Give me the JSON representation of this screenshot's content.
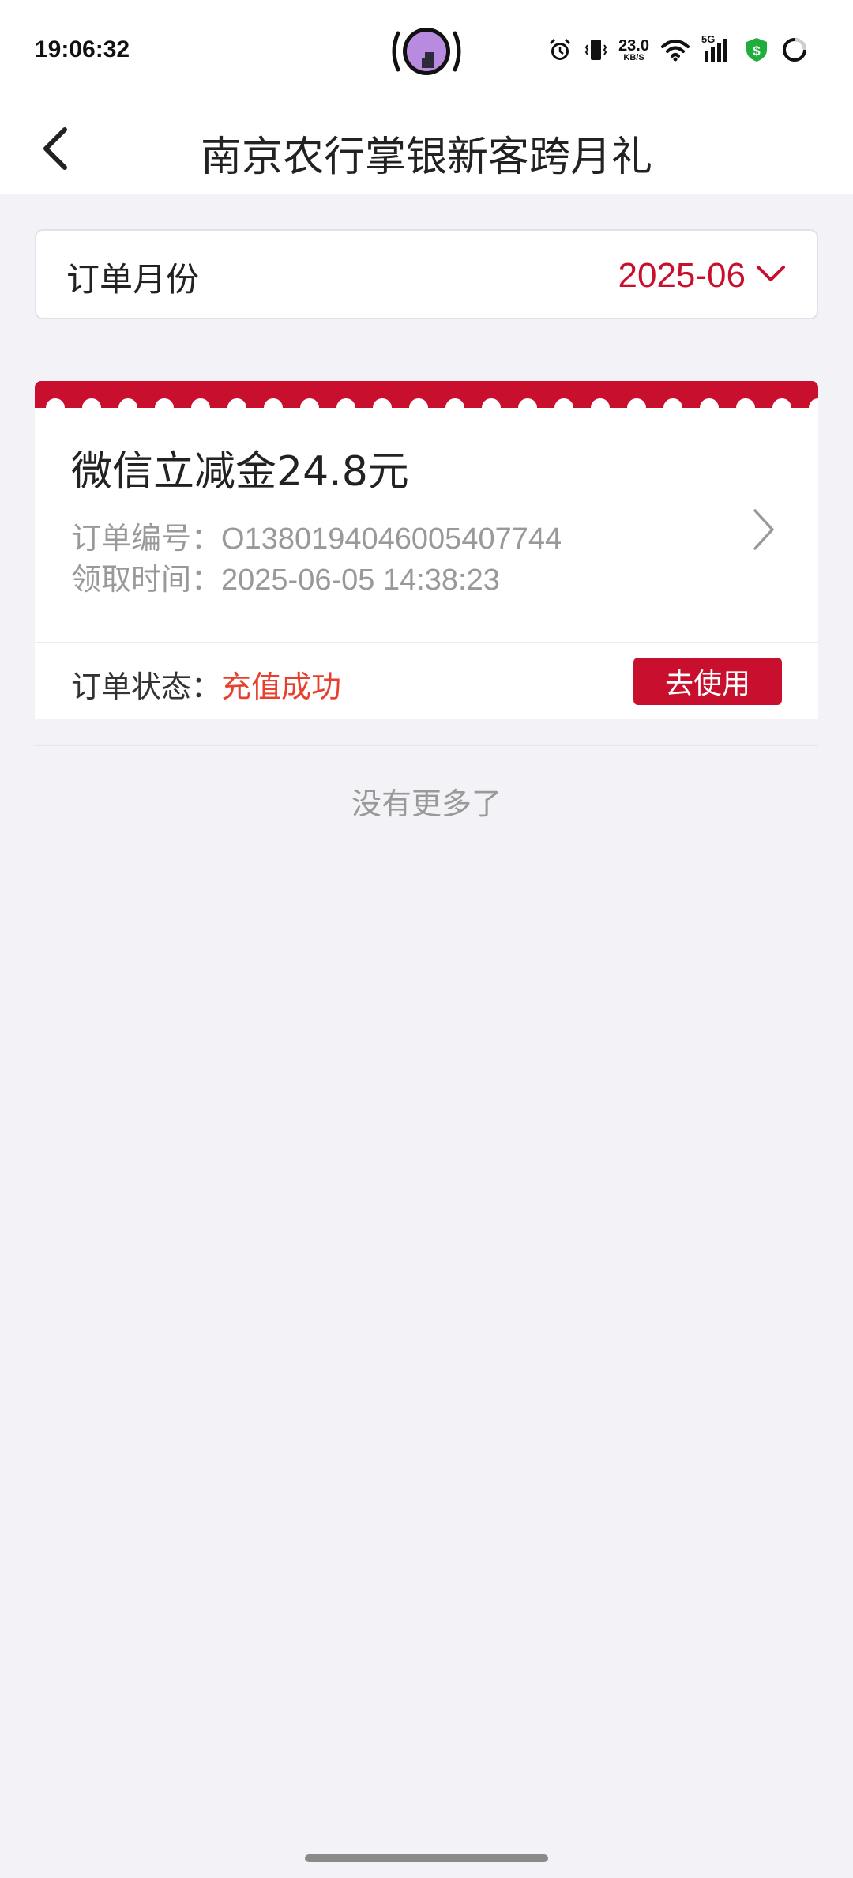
{
  "status_bar": {
    "time": "19:06:32",
    "net_speed_value": "23.0",
    "net_speed_unit": "KB/S",
    "network_type": "5G",
    "icons": [
      "alarm-icon",
      "vibrate-icon",
      "wifi-icon",
      "signal-icon",
      "shield-dollar-icon",
      "loading-ring-icon"
    ]
  },
  "header": {
    "title": "南京农行掌银新客跨月礼",
    "back_icon": "chevron-left-icon"
  },
  "filter": {
    "label": "订单月份",
    "value": "2025-06"
  },
  "order": {
    "title": "微信立减金24.8元",
    "order_no_label": "订单编号：",
    "order_no": "O1380194046005407744",
    "time_label": "领取时间：",
    "time": "2025-06-05 14:38:23",
    "status_label": "订单状态：",
    "status": "充值成功",
    "action_label": "去使用"
  },
  "footer": {
    "no_more": "没有更多了"
  },
  "colors": {
    "brand_red": "#c8102e",
    "status_red": "#e8402e",
    "background": "#f3f3f7"
  }
}
